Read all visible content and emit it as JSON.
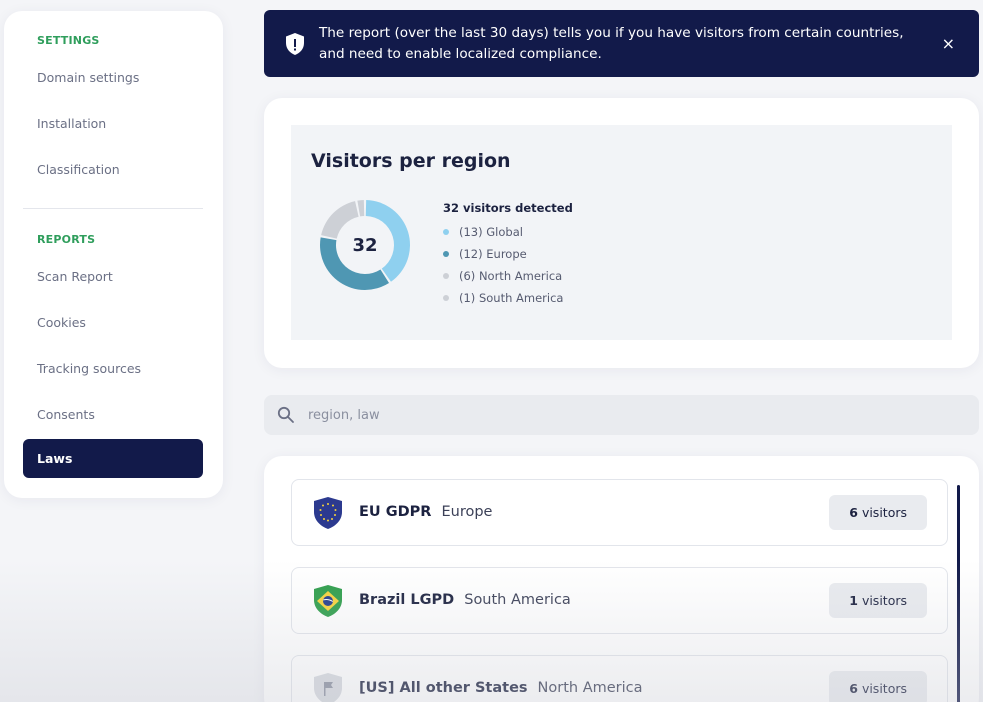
{
  "sidebar": {
    "settings_heading": "SETTINGS",
    "settings_items": [
      "Domain settings",
      "Installation",
      "Classification"
    ],
    "reports_heading": "REPORTS",
    "reports_items": [
      "Scan Report",
      "Cookies",
      "Tracking sources",
      "Consents"
    ],
    "active_item": "Laws"
  },
  "banner": {
    "text": "The report (over the last 30 days) tells you if you have visitors from certain countries, and need to enable localized compliance.",
    "close_label": "×"
  },
  "region": {
    "title": "Visitors per region",
    "total": "32",
    "detected_label": "32 visitors detected",
    "legend": [
      {
        "label": "(13) Global",
        "color": "#8fd0ef"
      },
      {
        "label": "(12) Europe",
        "color": "#4f97b3"
      },
      {
        "label": "(6) North America",
        "color": "#cdd0d6"
      },
      {
        "label": "(1) South America",
        "color": "#cdd0d6"
      }
    ]
  },
  "chart_data": {
    "type": "pie",
    "categories": [
      "Global",
      "Europe",
      "North America",
      "South America"
    ],
    "values": [
      13,
      12,
      6,
      1
    ],
    "colors": [
      "#8fd0ef",
      "#4f97b3",
      "#cdd0d6",
      "#cdd0d6"
    ],
    "title": "Visitors per region"
  },
  "search": {
    "placeholder": "region, law"
  },
  "laws": [
    {
      "name": "EU GDPR",
      "region": "Europe",
      "count": "6",
      "unit": "visitors",
      "flag": "eu-flag-icon"
    },
    {
      "name": "Brazil LGPD",
      "region": "South America",
      "count": "1",
      "unit": "visitors",
      "flag": "brazil-flag-icon"
    },
    {
      "name": "[US] All other States",
      "region": "North America",
      "count": "6",
      "unit": "visitors",
      "flag": "generic-flag-icon"
    }
  ]
}
